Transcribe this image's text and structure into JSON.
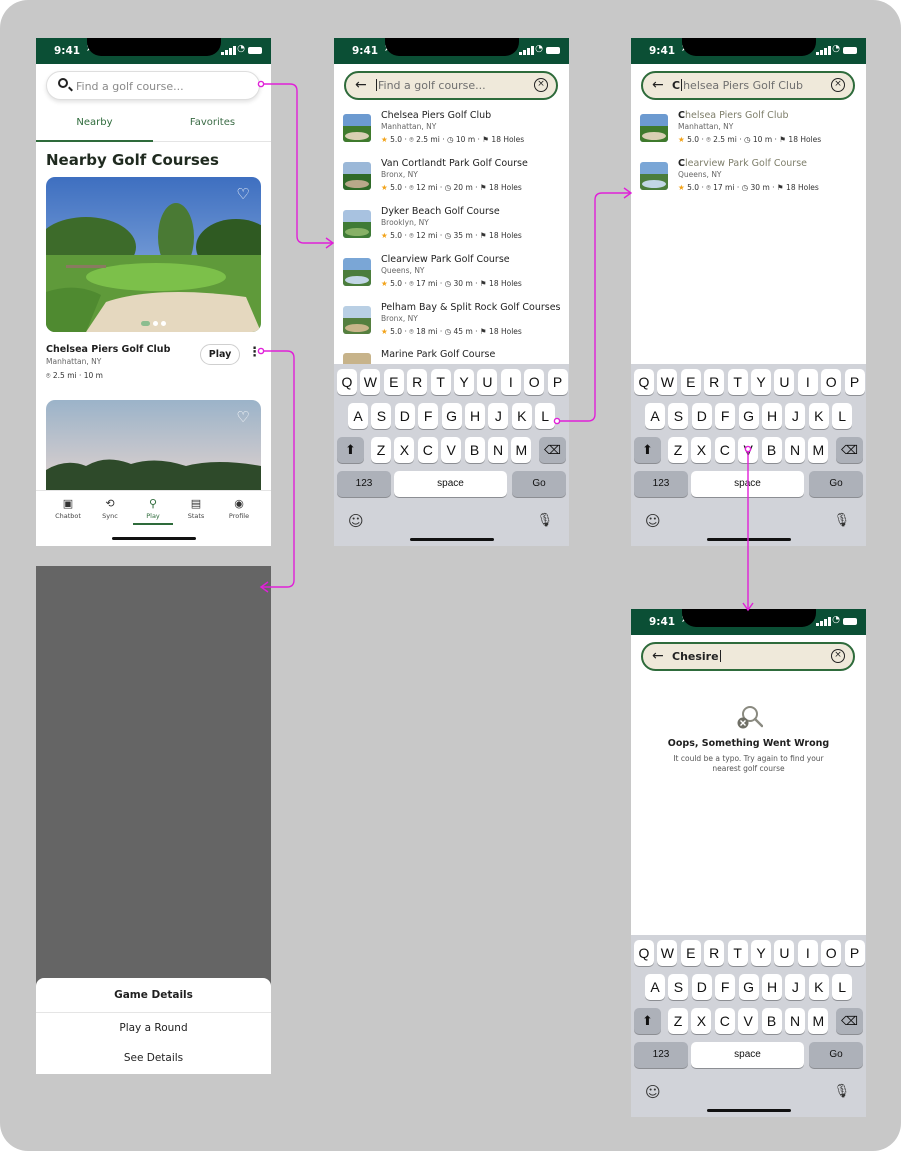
{
  "status": {
    "time": "9:41"
  },
  "screen1": {
    "search_placeholder": "Find a golf course...",
    "tabs": [
      "Nearby",
      "Favorites"
    ],
    "section_title": "Nearby Golf Courses",
    "card": {
      "name": "Chelsea Piers Golf Club",
      "location": "Manhattan, NY",
      "meta": "2.5 mi · 10 m",
      "play_label": "Play"
    },
    "nav": [
      {
        "label": "Chatbot",
        "icon": "chatbot-icon"
      },
      {
        "label": "Sync",
        "icon": "sync-icon"
      },
      {
        "label": "Play",
        "icon": "golf-ball-icon"
      },
      {
        "label": "Stats",
        "icon": "stats-icon"
      },
      {
        "label": "Profile",
        "icon": "profile-icon"
      }
    ]
  },
  "screen2": {
    "search_placeholder": "Find a golf course...",
    "courses": [
      {
        "name": "Chelsea Piers Golf Club",
        "location": "Manhattan, NY",
        "rating": "5.0",
        "distance": "2.5 mi",
        "time": "10 m",
        "holes": "18 Holes"
      },
      {
        "name": "Van Cortlandt Park Golf Course",
        "location": "Bronx, NY",
        "rating": "5.0",
        "distance": "12 mi",
        "time": "20 m",
        "holes": "18 Holes"
      },
      {
        "name": "Dyker Beach Golf Course",
        "location": "Brooklyn, NY",
        "rating": "5.0",
        "distance": "12 mi",
        "time": "35 m",
        "holes": "18 Holes"
      },
      {
        "name": "Clearview Park Golf Course",
        "location": "Queens, NY",
        "rating": "5.0",
        "distance": "17 mi",
        "time": "30 m",
        "holes": "18 Holes"
      },
      {
        "name": "Pelham Bay & Split Rock Golf Courses",
        "location": "Bronx, NY",
        "rating": "5.0",
        "distance": "18 mi",
        "time": "45 m",
        "holes": "18 Holes"
      },
      {
        "name": "Marine Park Golf Course",
        "location": "",
        "rating": "",
        "distance": "",
        "time": "",
        "holes": ""
      }
    ]
  },
  "screen3": {
    "query_first": "C",
    "query_rest": "helsea Piers Golf Club",
    "results": [
      {
        "match": "C",
        "rest": "helsea Piers Golf Club",
        "location": "Manhattan, NY",
        "rating": "5.0",
        "distance": "2.5 mi",
        "time": "10 m",
        "holes": "18 Holes"
      },
      {
        "match": "C",
        "rest": "learview Park Golf Course",
        "location": "Queens, NY",
        "rating": "5.0",
        "distance": "17 mi",
        "time": "30 m",
        "holes": "18 Holes"
      }
    ]
  },
  "screen4": {
    "query": "Chesire",
    "empty_title": "Oops, Something Went Wrong",
    "empty_desc": "It could be a typo. Try again to find your nearest golf course"
  },
  "sheet": {
    "title": "Game Details",
    "options": [
      "Play a Round",
      "See Details"
    ]
  },
  "keyboard": {
    "row1": [
      "Q",
      "W",
      "E",
      "R",
      "T",
      "Y",
      "U",
      "I",
      "O",
      "P"
    ],
    "row2": [
      "A",
      "S",
      "D",
      "F",
      "G",
      "H",
      "J",
      "K",
      "L"
    ],
    "row3": [
      "Z",
      "X",
      "C",
      "V",
      "B",
      "N",
      "M"
    ],
    "num_label": "123",
    "space_label": "space",
    "go_label": "Go"
  },
  "colors": {
    "header_green": "#0b4f35",
    "accent_green": "#2e6b3b",
    "search_fill": "#efe9da",
    "flow_arrow": "#e020d8",
    "star": "#f2a31a"
  }
}
